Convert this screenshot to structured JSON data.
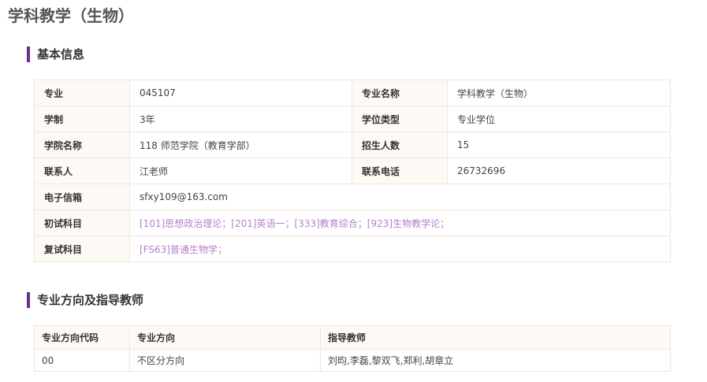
{
  "page": {
    "title": "学科教学（生物）"
  },
  "basic_info": {
    "section_title": "基本信息",
    "major_code_label": "专业",
    "major_code": "045107",
    "major_name_label": "专业名称",
    "major_name": "学科教学（生物）",
    "duration_label": "学制",
    "duration": "3年",
    "degree_type_label": "学位类型",
    "degree_type": "专业学位",
    "college_label": "学院名称",
    "college": "118 师范学院（教育学部）",
    "enrollment_label": "招生人数",
    "enrollment": "15",
    "contact_label": "联系人",
    "contact": "江老师",
    "phone_label": "联系电话",
    "phone": "26732696",
    "email_label": "电子信箱",
    "email": "sfxy109@163.com",
    "prelim_label": "初试科目",
    "prelim_subjects": "[101]思想政治理论；[201]英语一；[333]教育综合；[923]生物教学论；",
    "retest_label": "复试科目",
    "retest_subjects": "[FS63]普通生物学；"
  },
  "directions": {
    "section_title": "专业方向及指导教师",
    "headers": [
      "专业方向代码",
      "专业方向",
      "指导教师"
    ],
    "rows": [
      [
        "00",
        "不区分方向",
        "刘昀,李磊,黎双飞,郑利,胡章立"
      ]
    ]
  }
}
